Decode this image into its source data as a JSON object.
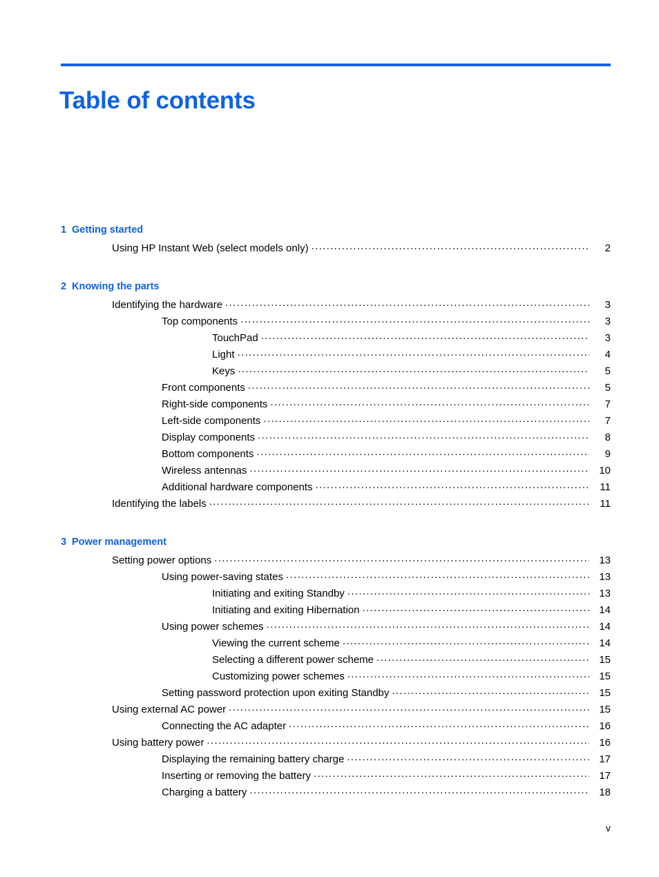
{
  "document": {
    "title": "Table of contents",
    "accent_color": "#0F62E0",
    "text_color": "#000000",
    "folio": "v"
  },
  "chapters": [
    {
      "number": "1",
      "title": "Getting started",
      "entries": [
        {
          "level": 1,
          "label": "Using HP Instant Web (select models only)",
          "page": "2"
        }
      ]
    },
    {
      "number": "2",
      "title": "Knowing the parts",
      "entries": [
        {
          "level": 1,
          "label": "Identifying the hardware",
          "page": "3"
        },
        {
          "level": 2,
          "label": "Top components",
          "page": "3"
        },
        {
          "level": 3,
          "label": "TouchPad",
          "page": "3"
        },
        {
          "level": 3,
          "label": "Light",
          "page": "4"
        },
        {
          "level": 3,
          "label": "Keys",
          "page": "5"
        },
        {
          "level": 2,
          "label": "Front components",
          "page": "5"
        },
        {
          "level": 2,
          "label": "Right-side components",
          "page": "7"
        },
        {
          "level": 2,
          "label": "Left-side components",
          "page": "7"
        },
        {
          "level": 2,
          "label": "Display components",
          "page": "8"
        },
        {
          "level": 2,
          "label": "Bottom components",
          "page": "9"
        },
        {
          "level": 2,
          "label": "Wireless antennas",
          "page": "10"
        },
        {
          "level": 2,
          "label": "Additional hardware components",
          "page": "11"
        },
        {
          "level": 1,
          "label": "Identifying the labels",
          "page": "11"
        }
      ]
    },
    {
      "number": "3",
      "title": "Power management",
      "entries": [
        {
          "level": 1,
          "label": "Setting power options",
          "page": "13"
        },
        {
          "level": 2,
          "label": "Using power-saving states",
          "page": "13"
        },
        {
          "level": 3,
          "label": "Initiating and exiting Standby",
          "page": "13"
        },
        {
          "level": 3,
          "label": "Initiating and exiting Hibernation",
          "page": "14"
        },
        {
          "level": 2,
          "label": "Using power schemes",
          "page": "14"
        },
        {
          "level": 3,
          "label": "Viewing the current scheme",
          "page": "14"
        },
        {
          "level": 3,
          "label": "Selecting a different power scheme",
          "page": "15"
        },
        {
          "level": 3,
          "label": "Customizing power schemes",
          "page": "15"
        },
        {
          "level": 2,
          "label": "Setting password protection upon exiting Standby",
          "page": "15"
        },
        {
          "level": 1,
          "label": "Using external AC power",
          "page": "15"
        },
        {
          "level": 2,
          "label": "Connecting the AC adapter",
          "page": "16"
        },
        {
          "level": 1,
          "label": "Using battery power",
          "page": "16"
        },
        {
          "level": 2,
          "label": "Displaying the remaining battery charge",
          "page": "17"
        },
        {
          "level": 2,
          "label": "Inserting or removing the battery",
          "page": "17"
        },
        {
          "level": 2,
          "label": "Charging a battery",
          "page": "18"
        }
      ]
    }
  ]
}
